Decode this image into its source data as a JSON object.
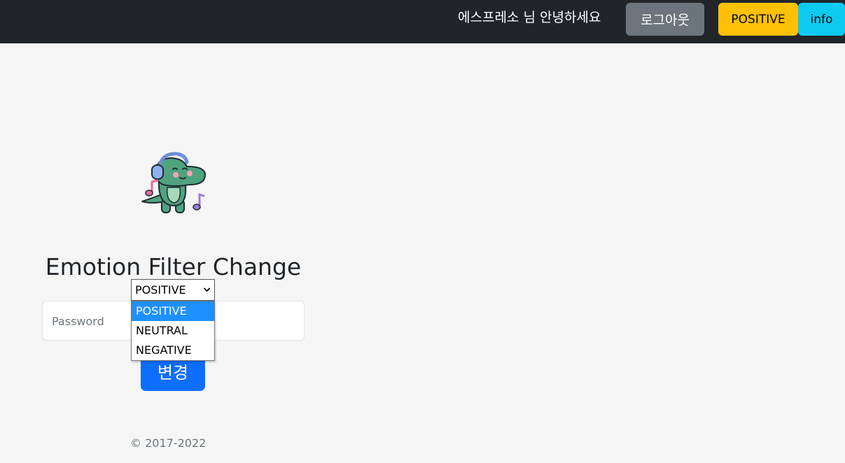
{
  "navbar": {
    "greeting": "에스프레소 님 안녕하세요",
    "logout_label": "로그아웃",
    "emotion_label": "POSITIVE",
    "info_label": "info"
  },
  "main": {
    "mascot_icon": "dinosaur-headphones-icon",
    "title": "Emotion Filter Change",
    "emotion_select": {
      "selected": "POSITIVE",
      "options": [
        "POSITIVE",
        "NEUTRAL",
        "NEGATIVE"
      ]
    },
    "password_placeholder": "Password",
    "submit_label": "변경"
  },
  "footer": {
    "copyright": "© 2017-2022"
  },
  "colors": {
    "navbar_bg": "#212529",
    "logout_bg": "#6c757d",
    "positive_bg": "#ffc107",
    "info_bg": "#0dcaf0",
    "primary": "#0d6efd",
    "page_bg": "#f5f5f5"
  }
}
